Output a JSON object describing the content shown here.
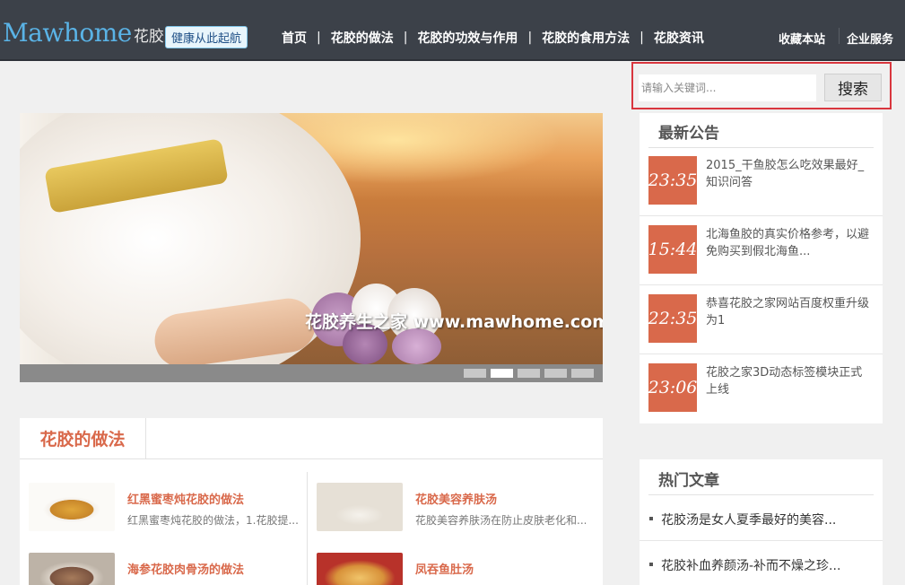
{
  "header": {
    "logo_en": "Mawhome",
    "logo_cn": "花胶之家",
    "slogan": "健康从此起航",
    "nav": [
      "首页",
      "花胶的做法",
      "花胶的功效与作用",
      "花胶的食用方法",
      "花胶资讯"
    ],
    "favorite": "收藏本站",
    "enterprise": "企业服务"
  },
  "search": {
    "placeholder": "请输入关键词...",
    "button": "搜索"
  },
  "slider": {
    "caption": "花胶养生之家 www.mawhome.com",
    "dot_count": 5,
    "active_index": 1
  },
  "announcements": {
    "title": "最新公告",
    "items": [
      {
        "time": "23:35",
        "text": "2015_干鱼胶怎么吃效果最好_知识问答"
      },
      {
        "time": "15:44",
        "text": "北海鱼胶的真实价格参考，以避免购买到假北海鱼..."
      },
      {
        "time": "22:35",
        "text": "恭喜花胶之家网站百度权重升级为1"
      },
      {
        "time": "23:06",
        "text": "花胶之家3D动态标签模块正式上线"
      }
    ]
  },
  "hot": {
    "title": "热门文章",
    "items": [
      "花胶汤是女人夏季最好的美容...",
      "花胶补血养颜汤-补而不燥之珍..."
    ]
  },
  "recipes": {
    "tab": "花胶的做法",
    "items": [
      {
        "title": "红黑蜜枣炖花胶的做法",
        "desc": "红黑蜜枣炖花胶的做法，1.花胶提..."
      },
      {
        "title": "花胶美容养肤汤",
        "desc": "花胶美容养肤汤在防止皮肤老化和..."
      },
      {
        "title": "海参花胶肉骨汤的做法",
        "desc": ""
      },
      {
        "title": "凤吞鱼肚汤",
        "desc": ""
      }
    ]
  },
  "colors": {
    "header_bg": "#3c4149",
    "accent": "#d9694b",
    "search_highlight": "#d9363e",
    "logo_blue": "#5ab3e6"
  }
}
